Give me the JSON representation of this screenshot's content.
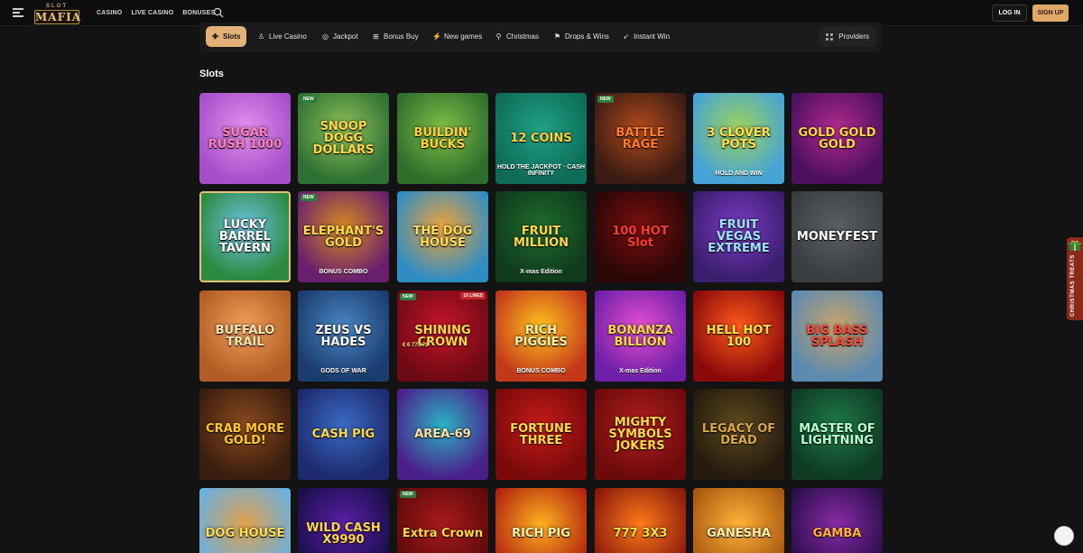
{
  "header": {
    "logo_top": "SLOT",
    "logo_main": "MAFIA",
    "nav": [
      "CASINO",
      "LIVE CASINO",
      "BONUSES"
    ],
    "login_label": "LOG IN",
    "signup_label": "SIGN UP"
  },
  "categories": [
    {
      "label": "Slots",
      "icon": "slots-icon",
      "active": true
    },
    {
      "label": "Live Casino",
      "icon": "live-casino-icon",
      "active": false
    },
    {
      "label": "Jackpot",
      "icon": "jackpot-icon",
      "active": false
    },
    {
      "label": "Bonus Buy",
      "icon": "bonus-buy-icon",
      "active": false
    },
    {
      "label": "New games",
      "icon": "new-games-icon",
      "active": false
    },
    {
      "label": "Christmas",
      "icon": "christmas-icon",
      "active": false
    },
    {
      "label": "Drops & Wins",
      "icon": "drops-wins-icon",
      "active": false
    },
    {
      "label": "Instant Win",
      "icon": "instant-win-icon",
      "active": false
    }
  ],
  "providers_label": "Providers",
  "section_title": "Slots",
  "badges": {
    "new": "NEW",
    "lines": "10 LINES"
  },
  "games": [
    {
      "title": "SUGAR RUSH 1000",
      "bg": "#a44fc9",
      "bg2": "#e58ff0",
      "fg": "#ff7ec0"
    },
    {
      "title": "SNOOP DOGG DOLLARS",
      "bg": "#2e6f33",
      "bg2": "#8fc25a",
      "fg": "#ffd84a",
      "new": true
    },
    {
      "title": "BUILDIN' BUCKS",
      "bg": "#2f6d2b",
      "bg2": "#7fbf48",
      "fg": "#ffcf3d"
    },
    {
      "title": "12 COINS",
      "sub": "HOLD THE JACKPOT · CASH INFINITY",
      "bg": "#0e6b57",
      "bg2": "#1fa184",
      "fg": "#ffd23c"
    },
    {
      "title": "BATTLE RAGE",
      "bg": "#3a1a12",
      "bg2": "#b14b1e",
      "fg": "#ff7b2a",
      "new": true
    },
    {
      "title": "3 CLOVER POTS",
      "sub": "HOLD AND WIN",
      "bg": "#45a3d6",
      "bg2": "#9ed35a",
      "fg": "#ffe04a"
    },
    {
      "title": "GOLD GOLD GOLD",
      "bg": "#4a0f5e",
      "bg2": "#b22a8c",
      "fg": "#ffd34a"
    },
    {
      "title": "LUCKY BARREL TAVERN",
      "bg": "#2b8a3e",
      "bg2": "#6fc4e6",
      "fg": "#ffffff"
    },
    {
      "title": "ELEPHANT'S GOLD",
      "sub": "BONUS COMBO",
      "bg": "#6a1f6e",
      "bg2": "#d68a1f",
      "fg": "#ffd84a",
      "new": true
    },
    {
      "title": "THE DOG HOUSE",
      "bg": "#2f8dc4",
      "bg2": "#f0a23a",
      "fg": "#ffdd55"
    },
    {
      "title": "FRUIT MILLION",
      "sub": "X-mas Edition",
      "bg": "#0f3b1c",
      "bg2": "#1e6b2e",
      "fg": "#ffd84a"
    },
    {
      "title": "100 HOT Slot",
      "bg": "#2a0606",
      "bg2": "#7a0f0f",
      "fg": "#ff3b2a"
    },
    {
      "title": "FRUIT VEGAS EXTREME",
      "bg": "#3b1d6e",
      "bg2": "#7a3bc4",
      "fg": "#9ee2ff"
    },
    {
      "title": "MONEYFEST",
      "bg": "#3a3d40",
      "bg2": "#5a5e62",
      "fg": "#ffffff"
    },
    {
      "title": "BUFFALO TRAIL",
      "bg": "#b35b24",
      "bg2": "#f0a05a",
      "fg": "#ffe6b0"
    },
    {
      "title": "ZEUS VS HADES",
      "sub": "GODS OF WAR",
      "bg": "#1a3c6e",
      "bg2": "#4a86c4",
      "fg": "#ffffff"
    },
    {
      "title": "SHINING CROWN",
      "bg": "#6e0a14",
      "bg2": "#c4142a",
      "fg": "#ffd84a",
      "new": true,
      "lines": true,
      "jackpot": "€ 6 775.71"
    },
    {
      "title": "RICH PIGGIES",
      "sub": "BONUS COMBO",
      "bg": "#c4381a",
      "bg2": "#ffc21f",
      "fg": "#fff2a8"
    },
    {
      "title": "BONANZA BILLION",
      "sub": "X-mas Edition",
      "bg": "#6e1fa8",
      "bg2": "#e44fd0",
      "fg": "#ffd84a"
    },
    {
      "title": "HELL HOT 100",
      "bg": "#8a0a0a",
      "bg2": "#ff5a1a",
      "fg": "#ffe04a"
    },
    {
      "title": "BIG BASS SPLASH",
      "bg": "#5a8ab0",
      "bg2": "#c9a46a",
      "fg": "#ff4a3a"
    },
    {
      "title": "CRAB MORE GOLD!",
      "bg": "#3a1d0e",
      "bg2": "#8a4a1e",
      "fg": "#ffc82a"
    },
    {
      "title": "CASH PIG",
      "bg": "#1d2a6e",
      "bg2": "#3a6ac4",
      "fg": "#ffd84a"
    },
    {
      "title": "AREA-69",
      "bg": "#4a1f8a",
      "bg2": "#2ab3c4",
      "fg": "#ffe0a0"
    },
    {
      "title": "FORTUNE THREE",
      "bg": "#7a0a0a",
      "bg2": "#c41a1a",
      "fg": "#ffd84a"
    },
    {
      "title": "MIGHTY SYMBOLS JOKERS",
      "bg": "#6e0a0a",
      "bg2": "#b01f1f",
      "fg": "#ffd84a"
    },
    {
      "title": "LEGACY OF DEAD",
      "bg": "#241a0e",
      "bg2": "#5e4a1e",
      "fg": "#d9a64a"
    },
    {
      "title": "MASTER OF LIGHTNING",
      "bg": "#0e3a24",
      "bg2": "#1f7a4a",
      "fg": "#b8ffcf"
    },
    {
      "title": "DOG HOUSE",
      "bg": "#6ab0e0",
      "bg2": "#e0a04a",
      "fg": "#ffdd55"
    },
    {
      "title": "WILD CASH X9990",
      "bg": "#1a0e4a",
      "bg2": "#5a1fa8",
      "fg": "#ffd84a"
    },
    {
      "title": "Extra Crown",
      "bg": "#5e0a0a",
      "bg2": "#a81a1a",
      "fg": "#ffd84a",
      "new": true
    },
    {
      "title": "RICH PIG",
      "bg": "#b3250e",
      "bg2": "#ffb21f",
      "fg": "#fff2a8"
    },
    {
      "title": "777 3X3",
      "bg": "#8a1a0a",
      "bg2": "#ff7a1a",
      "fg": "#ffe04a"
    },
    {
      "title": "GANESHA",
      "bg": "#a85a0e",
      "bg2": "#ffb23a",
      "fg": "#fff0b0"
    },
    {
      "title": "GAMBA",
      "bg": "#2a0e4a",
      "bg2": "#8a2aa8",
      "fg": "#ffb23a"
    }
  ],
  "side_widget_label": "CHRISTMAS TREATS"
}
